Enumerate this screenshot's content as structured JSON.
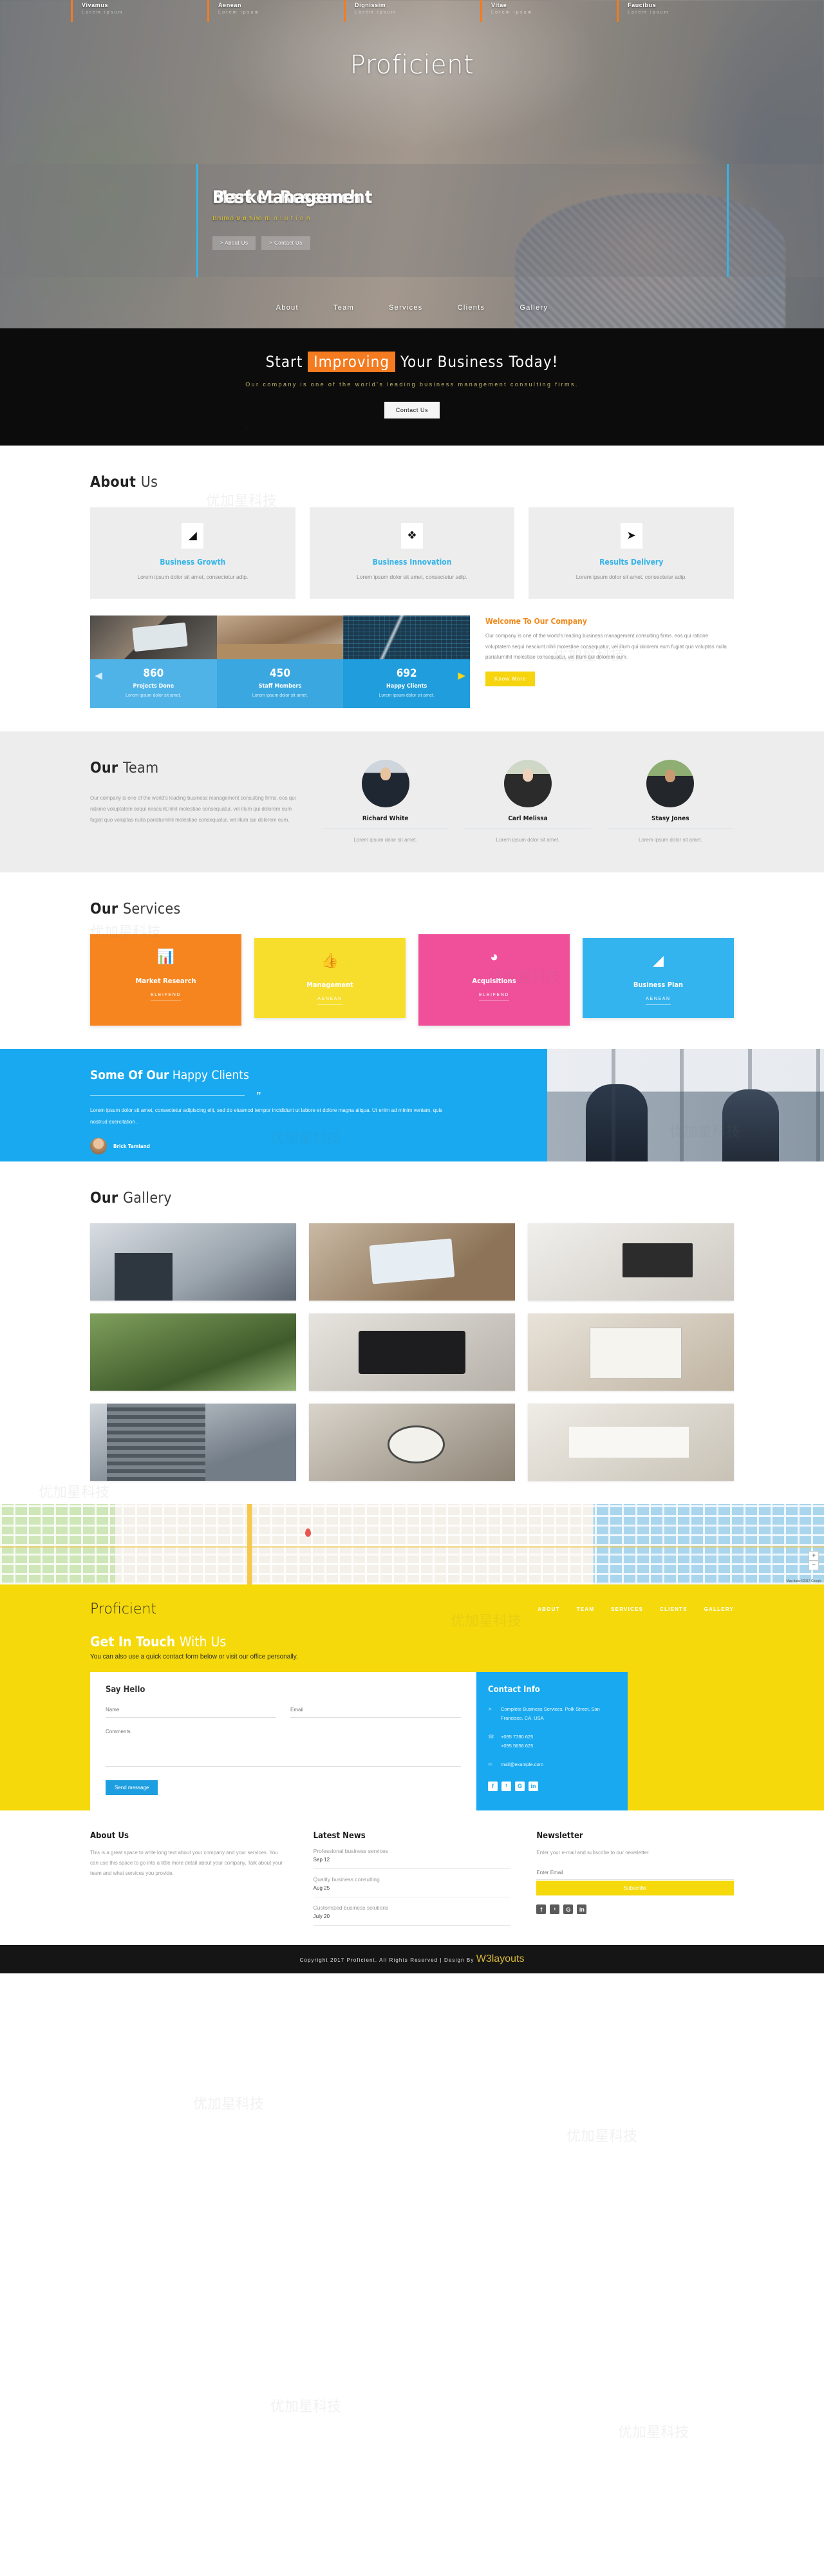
{
  "site": {
    "brand": "Proficient"
  },
  "topstrip": [
    {
      "title": "Vivamus",
      "sub": "Lorem ipsum"
    },
    {
      "title": "Aenean",
      "sub": "Lorem ipsum"
    },
    {
      "title": "Dignissim",
      "sub": "Lorem ipsum"
    },
    {
      "title": "Vitae",
      "sub": "Lorem ipsum"
    },
    {
      "title": "Faucibus",
      "sub": "Lorem ipsum"
    }
  ],
  "hero": {
    "slides": [
      {
        "title": "Market Research",
        "sub": "Business Solution"
      },
      {
        "title": "Best Management",
        "sub": "Innovation"
      }
    ],
    "buttons": [
      "> About Us",
      "> Contact Us"
    ],
    "nav": [
      "About",
      "Team",
      "Services",
      "Clients",
      "Gallery"
    ]
  },
  "cta": {
    "line_a": "Start ",
    "highlight": "Improving",
    "line_b": " Your Business Today!",
    "paragraph": "Our company is one of the world's leading business management consulting firms.",
    "button": "Contact Us"
  },
  "about": {
    "title_bold": "About",
    "title_light": "Us",
    "cards": [
      {
        "icon": "chart-area-icon",
        "glyph": "◢",
        "title": "Business Growth",
        "text": "Lorem ipsum dolor sit amet, consectetur adip."
      },
      {
        "icon": "cubes-icon",
        "glyph": "❖",
        "title": "Business Innovation",
        "text": "Lorem ipsum dolor sit amet, consectetur adip."
      },
      {
        "icon": "paper-plane-icon",
        "glyph": "➤",
        "title": "Results Delivery",
        "text": "Lorem ipsum dolor sit amet, consectetur adip."
      }
    ],
    "stats": [
      {
        "number": "860",
        "label": "Projects Done",
        "text": "Lorem ipsum dolor sit amet."
      },
      {
        "number": "450",
        "label": "Staff Members",
        "text": "Lorem ipsum dolor sit amet."
      },
      {
        "number": "692",
        "label": "Happy Clients",
        "text": "Lorem ipsum dolor sit amet."
      }
    ],
    "welcome": {
      "heading": "Welcome To Our Company",
      "text": "Our company is one of the world's leading business management consulting firms. eos qui ratione voluptatem sequi nesciunt.nihil molestiae consequatur, vel illum qui dolorem eum fugiat quo voluptas nulla pariaturnihil molestiae consequatur, vel illum qui dolorem eum.",
      "button": "Know More"
    }
  },
  "team": {
    "title_bold": "Our",
    "title_light": "Team",
    "text": "Our company is one of the world's leading business management consulting firms. eos qui ratione voluptatem sequi nesciunt.nihil molestiae consequatur, vel illum qui dolorem eum fugiat quo voluptas nulla pariaturnihil molestiae consequatur, vel illum qui dolorem eum.",
    "members": [
      {
        "name": "Richard White",
        "desc": "Lorem ipsum dolor sit amet."
      },
      {
        "name": "Carl Melissa",
        "desc": "Lorem ipsum dolor sit amet."
      },
      {
        "name": "Stasy Jones",
        "desc": "Lorem ipsum dolor sit amet."
      }
    ]
  },
  "services": {
    "title_bold": "Our",
    "title_light": "Services",
    "cards": [
      {
        "icon": "bar-chart-icon",
        "glyph": "ᴸ",
        "title": "Market Research",
        "sub": "ELEIFEND"
      },
      {
        "icon": "thumbs-up-icon",
        "glyph": "☝",
        "title": "Management",
        "sub": "AENEAN"
      },
      {
        "icon": "pie-chart-icon",
        "glyph": "◔",
        "title": "Acquisitions",
        "sub": "ELEIFEND"
      },
      {
        "icon": "area-chart-icon",
        "glyph": "◢",
        "title": "Business Plan",
        "sub": "AENEAN"
      }
    ]
  },
  "clients": {
    "title_bold": "Some Of Our",
    "title_light": "Happy Clients",
    "quote_mark": "”",
    "quote": "Lorem ipsum dolor sit amet, consectetur adipiscing elit, sed do eiusmod tempor incididunt ut labore et dolore magna aliqua. Ut enim ad minim veniam, quis nostrud exercitation .",
    "author": "Brick Tamland"
  },
  "gallery": {
    "title_bold": "Our",
    "title_light": "Gallery",
    "items": [
      "office-interior",
      "tablet-on-desk",
      "desk-with-coffee",
      "green-trees",
      "tablet-and-notebook",
      "hands-with-document",
      "building-facade",
      "compass-on-map",
      "person-writing"
    ]
  },
  "map": {
    "zoom_in": "+",
    "zoom_out": "−",
    "attribution": "Map data ©2017 Google"
  },
  "contact": {
    "brand": "Proficient",
    "nav": [
      "ABOUT",
      "TEAM",
      "SERVICES",
      "CLIENTS",
      "GALLERY"
    ],
    "title_bold": "Get In Touch",
    "title_light": "With Us",
    "subtitle": "You can also use a quick contact form below or visit our office personally.",
    "form": {
      "heading": "Say Hello",
      "name_placeholder": "Name",
      "email_placeholder": "Email",
      "comments_placeholder": "Comments",
      "submit": "Send message"
    },
    "info": {
      "heading": "Contact Info",
      "address": "Complete Business Services, Polk Street, San Francisco, CA, USA",
      "phone1": "+095 7780 625",
      "phone2": "+095 5658 625",
      "email": "mail@example.com",
      "socials": [
        {
          "name": "facebook-icon",
          "glyph": "f"
        },
        {
          "name": "twitter-icon",
          "glyph": "ᵗ"
        },
        {
          "name": "google-plus-icon",
          "glyph": "G"
        },
        {
          "name": "linkedin-icon",
          "glyph": "in"
        }
      ]
    }
  },
  "footer": {
    "about": {
      "heading": "About Us",
      "text": "This is a great space to write long text about your company and your services. You can use this space to go into a little more detail about your company. Talk about your team and what services you provide."
    },
    "news": {
      "heading": "Latest News",
      "items": [
        {
          "title": "Professional business services",
          "date": "Sep 12"
        },
        {
          "title": "Quality business consulting",
          "date": "Aug 25"
        },
        {
          "title": "Customized business solutions",
          "date": "July 20"
        }
      ]
    },
    "newsletter": {
      "heading": "Newsletter",
      "text": "Enter your e-mail and subscribe to our newsletter.",
      "placeholder": "Enter Email",
      "button": "Subscribe",
      "socials": [
        {
          "name": "facebook-icon",
          "glyph": "f"
        },
        {
          "name": "twitter-icon",
          "glyph": "ᵗ"
        },
        {
          "name": "google-plus-icon",
          "glyph": "G"
        },
        {
          "name": "linkedin-icon",
          "glyph": "in"
        }
      ]
    },
    "copyright_before": "Copyright 2017 Proficient. All Rights Reserved | Design By ",
    "copyright_link": "W3layouts"
  },
  "colors": {
    "orange": "#f47b20",
    "yellow": "#f5d90a",
    "blue": "#18a9f0",
    "pink": "#f0509a",
    "dark": "#0c0c0c"
  }
}
